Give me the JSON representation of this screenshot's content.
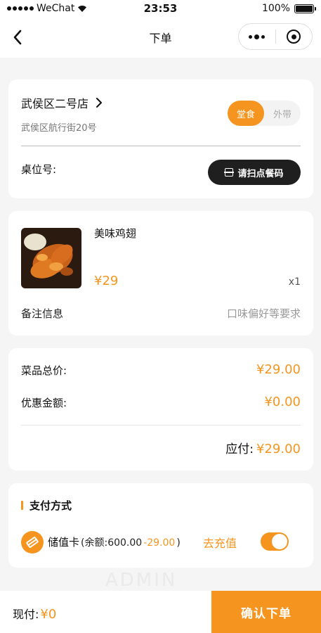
{
  "status_bar": {
    "carrier": "WeChat",
    "time": "23:53",
    "battery": "100%"
  },
  "nav": {
    "title": "下单"
  },
  "store": {
    "name": "武侯区二号店",
    "address": "武侯区航行街20号",
    "mode_dine_in": "堂食",
    "mode_takeout": "外带",
    "table_label": "桌位号:",
    "scan_button": "请扫点餐码"
  },
  "item": {
    "name": "美味鸡翅",
    "price": "¥29",
    "quantity": "x1",
    "remark_label": "备注信息",
    "remark_placeholder": "口味偏好等要求"
  },
  "price_summary": {
    "subtotal_label": "菜品总价:",
    "subtotal_value": "¥29.00",
    "discount_label": "优惠金额:",
    "discount_value": "¥0.00",
    "payable_label": "应付:",
    "payable_value": "¥29.00"
  },
  "payment": {
    "title": "支付方式",
    "method": "储值卡",
    "balance_text": "(余额:600.00",
    "deduct_text": "-29.00",
    "balance_close": ")",
    "recharge": "去充值",
    "enabled": true
  },
  "bottom_bar": {
    "now_pay_label": "现付:",
    "now_pay_value": "¥0",
    "confirm_button": "确认下单"
  },
  "watermark": "ADMIN",
  "colors": {
    "accent": "#f5951f",
    "dark_button": "#1f1f1f",
    "background": "#f5f5f5"
  }
}
